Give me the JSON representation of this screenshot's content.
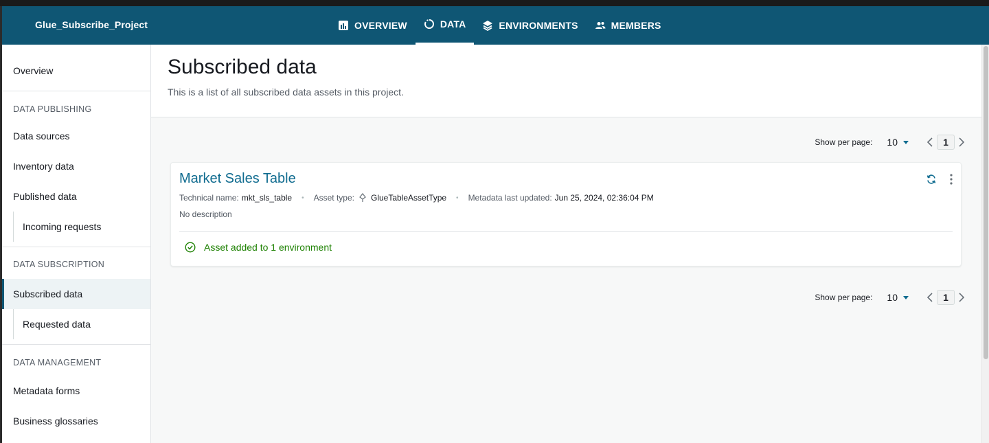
{
  "header": {
    "project_name": "Glue_Subscribe_Project",
    "tabs": [
      {
        "label": "OVERVIEW",
        "icon": "bar-chart-icon"
      },
      {
        "label": "DATA",
        "icon": "data-circle-icon",
        "active": true
      },
      {
        "label": "ENVIRONMENTS",
        "icon": "layers-icon"
      },
      {
        "label": "MEMBERS",
        "icon": "people-icon"
      }
    ],
    "bg_color": "#0f5674"
  },
  "sidebar": {
    "overview": "Overview",
    "sections": [
      {
        "title": "DATA PUBLISHING",
        "items": [
          "Data sources",
          "Inventory data",
          "Published data"
        ],
        "sub_items": [
          "Incoming requests"
        ]
      },
      {
        "title": "DATA SUBSCRIPTION",
        "items": [
          "Subscribed data"
        ],
        "sub_items": [
          "Requested data"
        ]
      },
      {
        "title": "DATA MANAGEMENT",
        "items": [
          "Metadata forms",
          "Business glossaries"
        ]
      }
    ],
    "active_item": "Subscribed data"
  },
  "page": {
    "title": "Subscribed data",
    "description": "This is a list of all subscribed data assets in this project."
  },
  "pagination": {
    "label": "Show per page:",
    "per_page": "10",
    "current_page": "1"
  },
  "asset": {
    "title": "Market Sales Table",
    "technical_name_label": "Technical name:",
    "technical_name": "mkt_sls_table",
    "asset_type_label": "Asset type:",
    "asset_type": "GlueTableAssetType",
    "metadata_label": "Metadata last updated:",
    "metadata_updated": "Jun 25, 2024, 02:36:04 PM",
    "description": "No description",
    "status": "Asset added to 1 environment",
    "status_color": "#1d8102"
  }
}
